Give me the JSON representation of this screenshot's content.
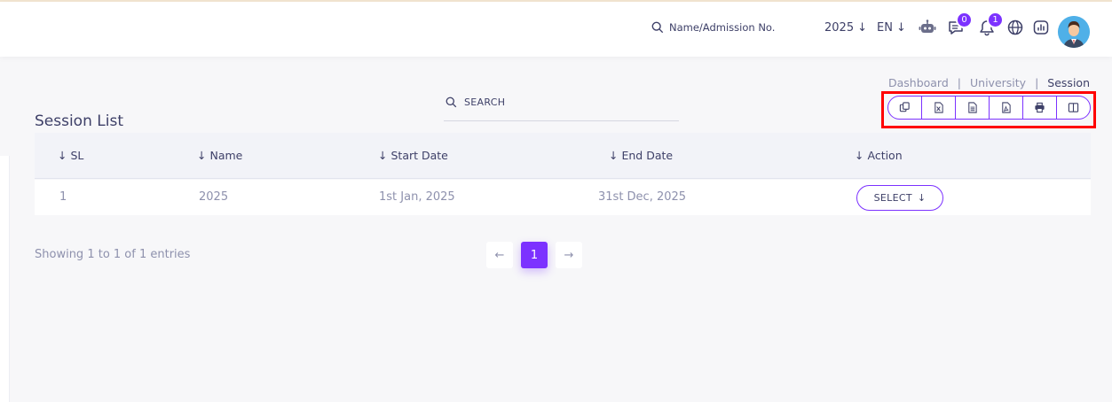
{
  "header": {
    "search_label": "Name/Admission No.",
    "year": "2025",
    "language": "EN",
    "icons": [
      "robot-icon",
      "chat-icon",
      "bell-icon",
      "globe-icon",
      "chart-icon"
    ],
    "chat_badge": "0",
    "notification_badge": "1",
    "accent_color": "#7c32ff"
  },
  "breadcrumb": {
    "items": [
      "Dashboard",
      "University",
      "Session"
    ],
    "separator": "|"
  },
  "page": {
    "title": "Session List",
    "search_placeholder": "SEARCH"
  },
  "export_buttons": [
    "copy-icon",
    "excel-icon",
    "csv-icon",
    "pdf-icon",
    "print-icon",
    "columns-icon"
  ],
  "table": {
    "columns": [
      "SL",
      "Name",
      "Start Date",
      "End Date",
      "Action"
    ],
    "sort_arrow": "↓",
    "rows": [
      {
        "sl": "1",
        "name": "2025",
        "start_date": "1st Jan, 2025",
        "end_date": "31st Dec, 2025",
        "action": "SELECT"
      }
    ]
  },
  "footer": {
    "info": "Showing 1 to 1 of 1 entries",
    "pages": [
      "1"
    ],
    "prev": "←",
    "next": "→"
  }
}
